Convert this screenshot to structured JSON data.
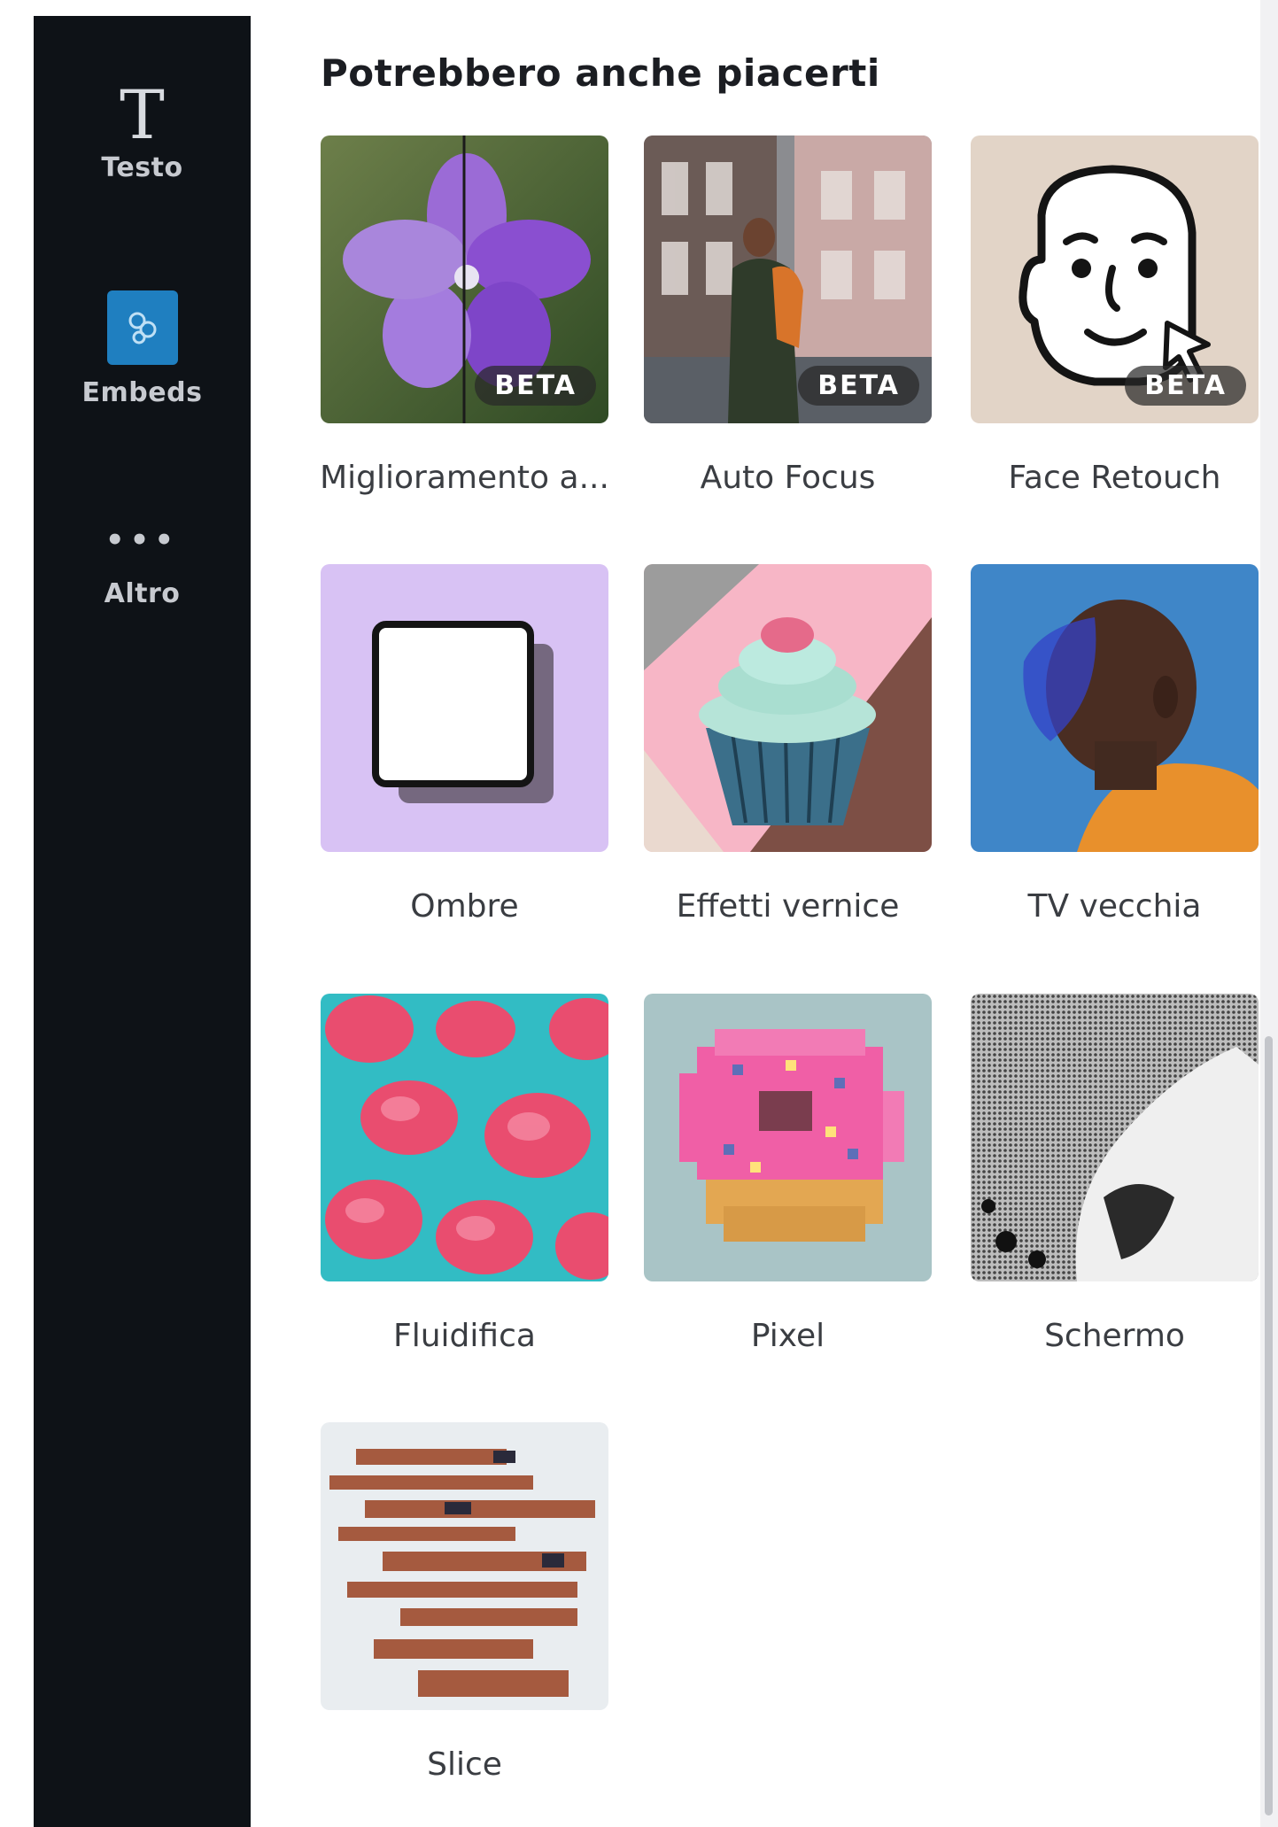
{
  "sidebar": {
    "items": [
      {
        "icon": "text-t-icon",
        "glyph": "T",
        "label": "Testo"
      },
      {
        "icon": "embeds-icon",
        "label": "Embeds"
      },
      {
        "icon": "more-dots-icon",
        "glyph": "•••",
        "label": "Altro"
      }
    ]
  },
  "panel": {
    "title": "Potrebbero anche piacerti",
    "badge_label": "BETA",
    "tiles": [
      {
        "label": "Miglioramento a...",
        "beta": true,
        "image": "purple-flower-photo"
      },
      {
        "label": "Auto Focus",
        "beta": true,
        "image": "man-in-street-photo"
      },
      {
        "label": "Face Retouch",
        "beta": true,
        "image": "face-retouch-illustration"
      },
      {
        "label": "Ombre",
        "beta": false,
        "image": "shadow-square-illustration"
      },
      {
        "label": "Effetti vernice",
        "beta": false,
        "image": "cupcake-art"
      },
      {
        "label": "TV vecchia",
        "beta": false,
        "image": "man-profile-photo"
      },
      {
        "label": "Fluidifica",
        "beta": false,
        "image": "pink-flowers-on-teal"
      },
      {
        "label": "Pixel",
        "beta": false,
        "image": "pixel-donut"
      },
      {
        "label": "Schermo",
        "beta": false,
        "image": "halftone-screen-photo"
      },
      {
        "label": "Slice",
        "beta": false,
        "image": "sliced-figure-photo"
      }
    ]
  },
  "colors": {
    "sidebar_bg": "#0e1217",
    "embeds_accent": "#1f7fc0",
    "ombre_bg": "#d8c2f4"
  }
}
